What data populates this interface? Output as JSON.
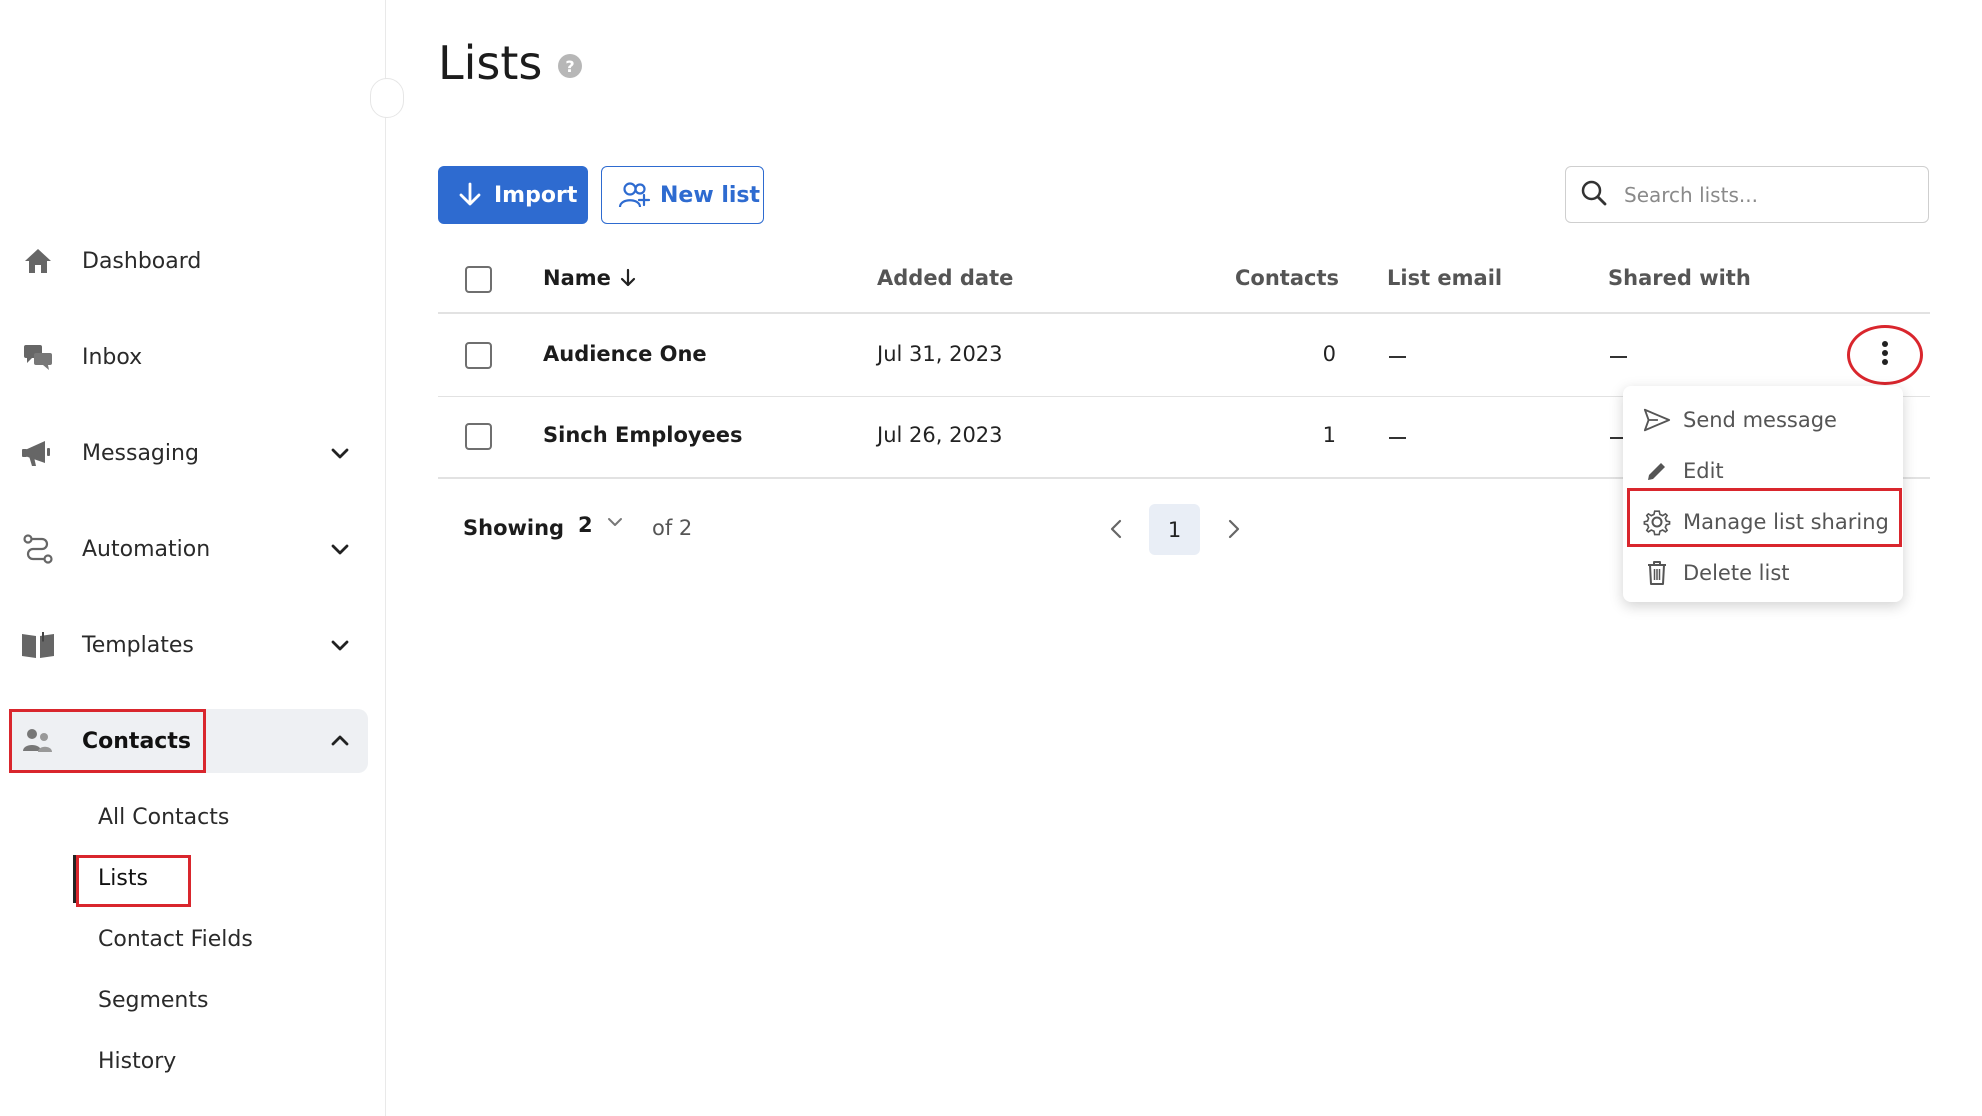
{
  "sidebar": {
    "items": [
      {
        "label": "Dashboard",
        "icon": "home-icon"
      },
      {
        "label": "Inbox",
        "icon": "chat-bubbles-icon"
      },
      {
        "label": "Messaging",
        "icon": "megaphone-icon"
      },
      {
        "label": "Automation",
        "icon": "route-icon"
      },
      {
        "label": "Templates",
        "icon": "book-icon"
      },
      {
        "label": "Contacts",
        "icon": "contacts-icon"
      }
    ],
    "contacts_sub": [
      "All Contacts",
      "Lists",
      "Contact Fields",
      "Segments",
      "History"
    ]
  },
  "page": {
    "title": "Lists"
  },
  "toolbar": {
    "import_label": "Import",
    "new_list_label": "New list",
    "search_placeholder": "Search lists..."
  },
  "table": {
    "columns": {
      "name": "Name",
      "added_date": "Added date",
      "contacts": "Contacts",
      "list_email": "List email",
      "shared_with": "Shared with"
    },
    "rows": [
      {
        "name": "Audience One",
        "added_date": "Jul 31, 2023",
        "contacts": "0"
      },
      {
        "name": "Sinch Employees",
        "added_date": "Jul 26, 2023",
        "contacts": "1"
      }
    ]
  },
  "row_menu": {
    "items": [
      "Send message",
      "Edit",
      "Manage list sharing",
      "Delete list"
    ]
  },
  "pagination": {
    "showing_label": "Showing",
    "page_size": "2",
    "of_total": "of 2",
    "current_page": "1"
  },
  "colors": {
    "primary": "#2e6bd0",
    "highlight": "#d9262d"
  }
}
